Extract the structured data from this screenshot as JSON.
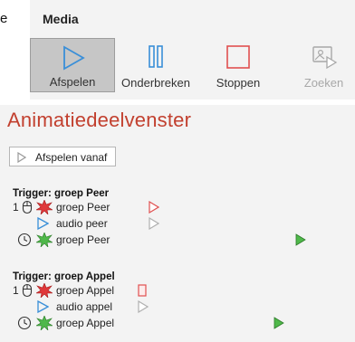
{
  "fragment": {
    "text": "e"
  },
  "ribbon": {
    "group_title": "Media",
    "buttons": [
      {
        "label": "Afspelen",
        "icon": "play-icon",
        "state": "selected"
      },
      {
        "label": "Onderbreken",
        "icon": "pause-icon",
        "state": "normal"
      },
      {
        "label": "Stoppen",
        "icon": "stop-icon",
        "state": "normal"
      },
      {
        "label": "Zoeken",
        "icon": "seek-icon",
        "state": "disabled"
      }
    ]
  },
  "pane": {
    "title": "Animatiedeelvenster",
    "play_from_label": "Afspelen vanaf",
    "groups": [
      {
        "trigger": "Trigger: groep Peer",
        "items": [
          {
            "number": "1",
            "icon": "mouse-click-icon",
            "effect_icon": "entrance-burst-red-icon",
            "label": "groep Peer",
            "marker": "red-triangle-outline"
          },
          {
            "number": "",
            "icon": "play-media-icon",
            "effect_icon": "",
            "label": "audio peer",
            "marker": "gray-triangle-outline"
          },
          {
            "number": "",
            "icon": "clock-icon",
            "effect_icon": "entrance-burst-green-icon",
            "label": "groep Peer",
            "marker": "green-triangle-filled"
          }
        ]
      },
      {
        "trigger": "Trigger: groep Appel",
        "items": [
          {
            "number": "1",
            "icon": "mouse-click-icon",
            "effect_icon": "entrance-burst-red-icon",
            "label": "groep Appel",
            "marker": "red-rectangle-outline"
          },
          {
            "number": "",
            "icon": "play-media-icon",
            "effect_icon": "",
            "label": "audio appel",
            "marker": "gray-triangle-outline"
          },
          {
            "number": "",
            "icon": "clock-icon",
            "effect_icon": "entrance-burst-green-icon",
            "label": "groep Appel",
            "marker": "green-triangle-filled"
          }
        ]
      }
    ]
  },
  "colors": {
    "title_red": "#c2402f",
    "play_blue": "#3a8fd8",
    "stop_red": "#e05050",
    "burst_red": "#e0383a",
    "burst_green": "#4fb84a",
    "selected_bg": "#c6c6c6",
    "panel_bg": "#f3f3f3"
  }
}
